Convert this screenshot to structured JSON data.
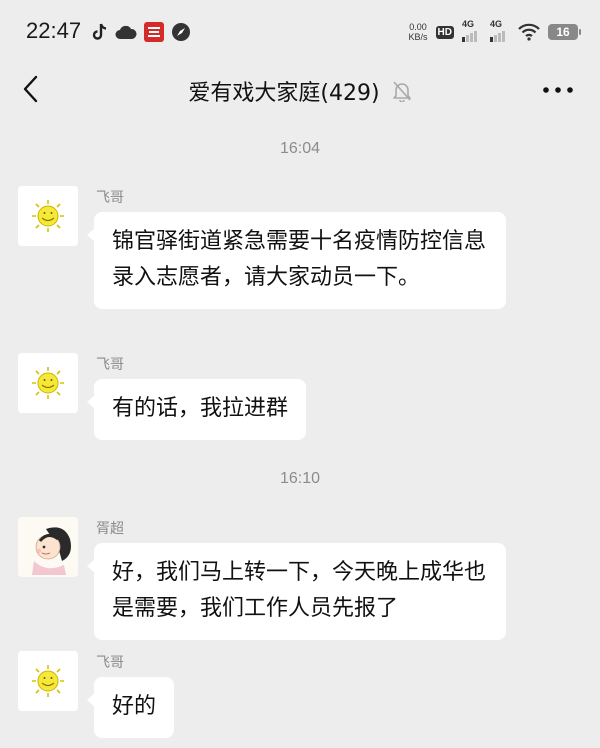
{
  "status_bar": {
    "time": "22:47",
    "left_icons": [
      "tiktok-icon",
      "cloud-icon",
      "app-icon",
      "compass-icon"
    ],
    "net_speed_value": "0.00",
    "net_speed_unit": "KB/s",
    "hd_label": "HD",
    "hd_sub": "1 2",
    "signal1_label": "4G",
    "signal2_label": "4G",
    "battery": "16"
  },
  "header": {
    "title": "爱有戏大家庭(429)",
    "muted_icon": "bell-off-icon"
  },
  "chat": {
    "timestamps": [
      "16:04",
      "16:10"
    ],
    "messages": [
      {
        "sender": "飞哥",
        "text": "锦官驿街道紧急需要十名疫情防控信息录入志愿者，请大家动员一下。",
        "avatar": "sun-avatar"
      },
      {
        "sender": "飞哥",
        "text": "有的话，我拉进群",
        "avatar": "sun-avatar"
      },
      {
        "sender": "胥超",
        "text": "好，我们马上转一下，今天晚上成华也是需要，我们工作人员先报了",
        "avatar": "cartoon-avatar"
      },
      {
        "sender": "飞哥",
        "text": "好的",
        "avatar": "sun-avatar"
      }
    ]
  }
}
